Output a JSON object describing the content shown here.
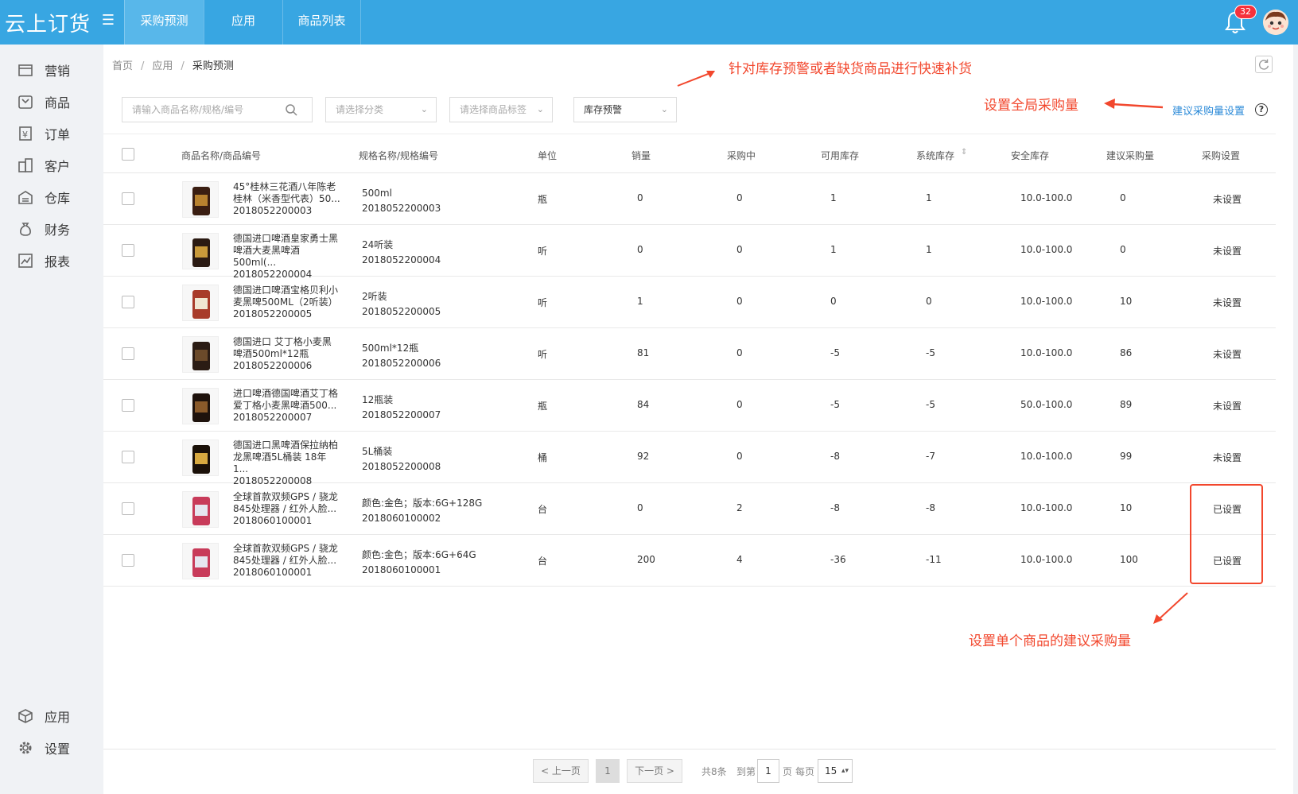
{
  "app": {
    "logo": "云上订货",
    "notification_count": "32"
  },
  "topnav": [
    "采购预测",
    "应用",
    "商品列表"
  ],
  "sidebar": {
    "items": [
      "营销",
      "商品",
      "订单",
      "客户",
      "仓库",
      "财务",
      "报表"
    ],
    "bottom": [
      "应用",
      "设置"
    ]
  },
  "breadcrumb": [
    "首页",
    "应用",
    "采购预测"
  ],
  "filters": {
    "search_placeholder": "请输入商品名称/规格/编号",
    "category_placeholder": "请选择分类",
    "tag_placeholder": "请选择商品标签",
    "stock_filter": "库存预警"
  },
  "settings_link": "建议采购量设置",
  "table": {
    "headers": [
      "商品名称/商品编号",
      "规格名称/规格编号",
      "单位",
      "销量",
      "采购中",
      "可用库存",
      "系统库存",
      "安全库存",
      "建议采购量",
      "采购设置"
    ],
    "rows": [
      {
        "name": "45°桂林三花酒八年陈老桂林（米香型代表）50...",
        "code": "2018052200003",
        "spec": "500ml",
        "spec_code": "2018052200003",
        "unit": "瓶",
        "sales": "0",
        "purchasing": "0",
        "available": "1",
        "system": "1",
        "safe": "10.0-100.0",
        "suggest": "0",
        "setting": "未设置"
      },
      {
        "name": "德国进口啤酒皇家勇士黑啤酒大麦黑啤酒500ml(...",
        "code": "2018052200004",
        "spec": "24听装",
        "spec_code": "2018052200004",
        "unit": "听",
        "sales": "0",
        "purchasing": "0",
        "available": "1",
        "system": "1",
        "safe": "10.0-100.0",
        "suggest": "0",
        "setting": "未设置"
      },
      {
        "name": "德国进口啤酒宝格贝利小麦黑啤500ML（2听装）",
        "code": "2018052200005",
        "spec": "2听装",
        "spec_code": "2018052200005",
        "unit": "听",
        "sales": "1",
        "purchasing": "0",
        "available": "0",
        "system": "0",
        "safe": "10.0-100.0",
        "suggest": "10",
        "setting": "未设置"
      },
      {
        "name": "德国进口 艾丁格小麦黑啤酒500ml*12瓶",
        "code": "2018052200006",
        "spec": "500ml*12瓶",
        "spec_code": "2018052200006",
        "unit": "听",
        "sales": "81",
        "purchasing": "0",
        "available": "-5",
        "system": "-5",
        "safe": "10.0-100.0",
        "suggest": "86",
        "setting": "未设置"
      },
      {
        "name": "进口啤酒德国啤酒艾丁格爱丁格小麦黑啤酒500...",
        "code": "2018052200007",
        "spec": "12瓶装",
        "spec_code": "2018052200007",
        "unit": "瓶",
        "sales": "84",
        "purchasing": "0",
        "available": "-5",
        "system": "-5",
        "safe": "50.0-100.0",
        "suggest": "89",
        "setting": "未设置"
      },
      {
        "name": "德国进口黑啤酒保拉纳柏龙黑啤酒5L桶装 18年1...",
        "code": "2018052200008",
        "spec": "5L桶装",
        "spec_code": "2018052200008",
        "unit": "桶",
        "sales": "92",
        "purchasing": "0",
        "available": "-8",
        "system": "-7",
        "safe": "10.0-100.0",
        "suggest": "99",
        "setting": "未设置"
      },
      {
        "name": "全球首款双频GPS / 骁龙845处理器 / 红外人脸...",
        "code": "2018060100001",
        "spec": "颜色:金色；版本:6G+128G",
        "spec_code": "2018060100002",
        "unit": "台",
        "sales": "0",
        "purchasing": "2",
        "available": "-8",
        "system": "-8",
        "safe": "10.0-100.0",
        "suggest": "10",
        "setting": "已设置"
      },
      {
        "name": "全球首款双频GPS / 骁龙845处理器 / 红外人脸...",
        "code": "2018060100001",
        "spec": "颜色:金色；版本:6G+64G",
        "spec_code": "2018060100001",
        "unit": "台",
        "sales": "200",
        "purchasing": "4",
        "available": "-36",
        "system": "-11",
        "safe": "10.0-100.0",
        "suggest": "100",
        "setting": "已设置"
      }
    ]
  },
  "pager": {
    "prev": "< 上一页",
    "current": "1",
    "next": "下一页 >",
    "total": "共8条",
    "goto": "到第",
    "goto_value": "1",
    "page_unit": "页",
    "per_page_label": "每页",
    "per_page": "15"
  },
  "annotations": {
    "top": "针对库存预警或者缺货商品进行快速补货",
    "global": "设置全局采购量",
    "single": "设置单个商品的建议采购量"
  },
  "colors": {
    "topbar": "#38a6e2",
    "annotation": "#f2472d",
    "link": "#2b8ad8"
  }
}
